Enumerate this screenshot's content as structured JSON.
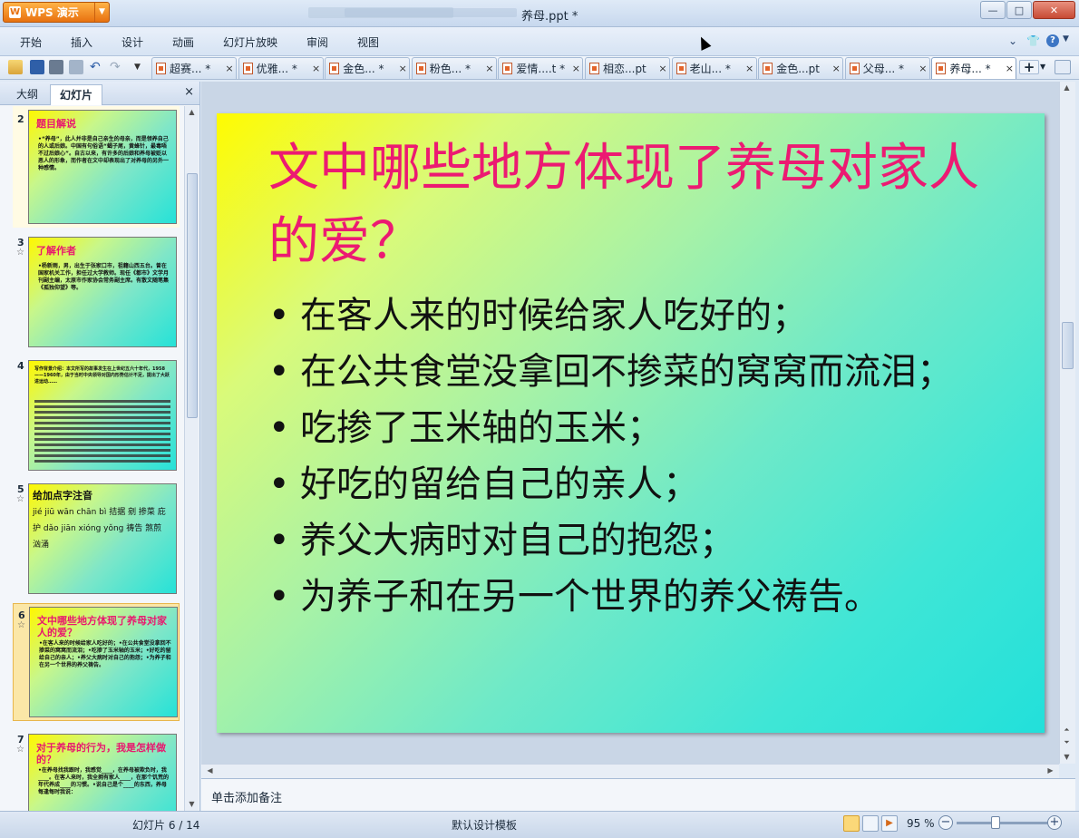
{
  "app": {
    "name": "WPS 演示",
    "doc_title": "养母.ppt * "
  },
  "window_controls": {
    "minimize": "—",
    "maximize": "□",
    "close": "✕"
  },
  "menu": [
    "开始",
    "插入",
    "设计",
    "动画",
    "幻灯片放映",
    "审阅",
    "视图"
  ],
  "tabs": [
    {
      "label": "超赛... *"
    },
    {
      "label": "优雅... *"
    },
    {
      "label": "金色... *"
    },
    {
      "label": "粉色... *"
    },
    {
      "label": "爱情....t *"
    },
    {
      "label": "相恋...pt"
    },
    {
      "label": "老山... *"
    },
    {
      "label": "金色...pt"
    },
    {
      "label": "父母... *"
    },
    {
      "label": "养母... *"
    }
  ],
  "tab_close": "×",
  "panel": {
    "tab_outline": "大纲",
    "tab_slides": "幻灯片",
    "close": "×"
  },
  "thumbnails": [
    {
      "num": "2",
      "title": "题目解说",
      "body": "•“养母”，此人并非是自己亲生的母亲，而是领养自己的人或后娘。中国有句俗语“蝎子尾，黄蜂针，最毒唔不过后娘心”。自古以来，有许多的后娘和养母被贬以恶人的形象，而作者在文中却表现出了对养母的另外一种感情。"
    },
    {
      "num": "3",
      "title": "了解作者",
      "body": "•杨新雨，男，出生于张家口市，祖籍山西五台。曾在国家机关工作，担任过大学教师。现任《都市》文学月刊副主编，太原市作家协会常务副主席。有散文随笔集《孤独仰望》等。"
    },
    {
      "num": "4",
      "title": "",
      "body": "写作背景介绍：本文所写的故事发生在上世纪五六十年代，1958——1960年，由于当时中央领导对国内形势估计不足，提出了大跃进运动……"
    },
    {
      "num": "5",
      "title": "给加点字注音",
      "body": "jié  jiū  wān  chān  bì  拮据  剜  掺菜  庇护  dǎo  jiān  xióng  yǒng  祷告  煞煎  汹涌"
    },
    {
      "num": "6",
      "title": "文中哪些地方体现了养母对家人的爱？",
      "body": "•在客人来的时候给家人吃好的；•在公共食堂没拿回不掺菜的窝窝而流泪；•吃掺了玉米轴的玉米；•好吃的留给自己的亲人；•养父大病时对自己的抱怨；•为养子和在另一个世界的养父祷告。"
    },
    {
      "num": "7",
      "title": "对于养母的行为，我是怎样做的？",
      "body": "•在养母找我跟时，我感觉____，在养母被欺负时，我____。在客人来时，我全拥有家人____，在那个饥荒的年代养成____的习惯。•说自己是个____的东西，养母每逢每时我说："
    }
  ],
  "slide": {
    "title": "文中哪些地方体现了养母对家人的爱？",
    "bullets": [
      "在客人来的时候给家人吃好的；",
      "在公共食堂没拿回不掺菜的窝窝而流泪；",
      "吃掺了玉米轴的玉米；",
      "好吃的留给自己的亲人；",
      "养父大病时对自己的抱怨；",
      "为养子和在另一个世界的养父祷告。"
    ]
  },
  "notes_placeholder": "单击添加备注",
  "status": {
    "slide_counter": "幻灯片 6 / 14",
    "template": "默认设计模板",
    "zoom": "95 %"
  },
  "colors": {
    "title_pink": "#ec1a72",
    "slide_gradient_start": "#fffb00",
    "slide_gradient_end": "#22e0da",
    "wps_orange": "#e8710f"
  }
}
